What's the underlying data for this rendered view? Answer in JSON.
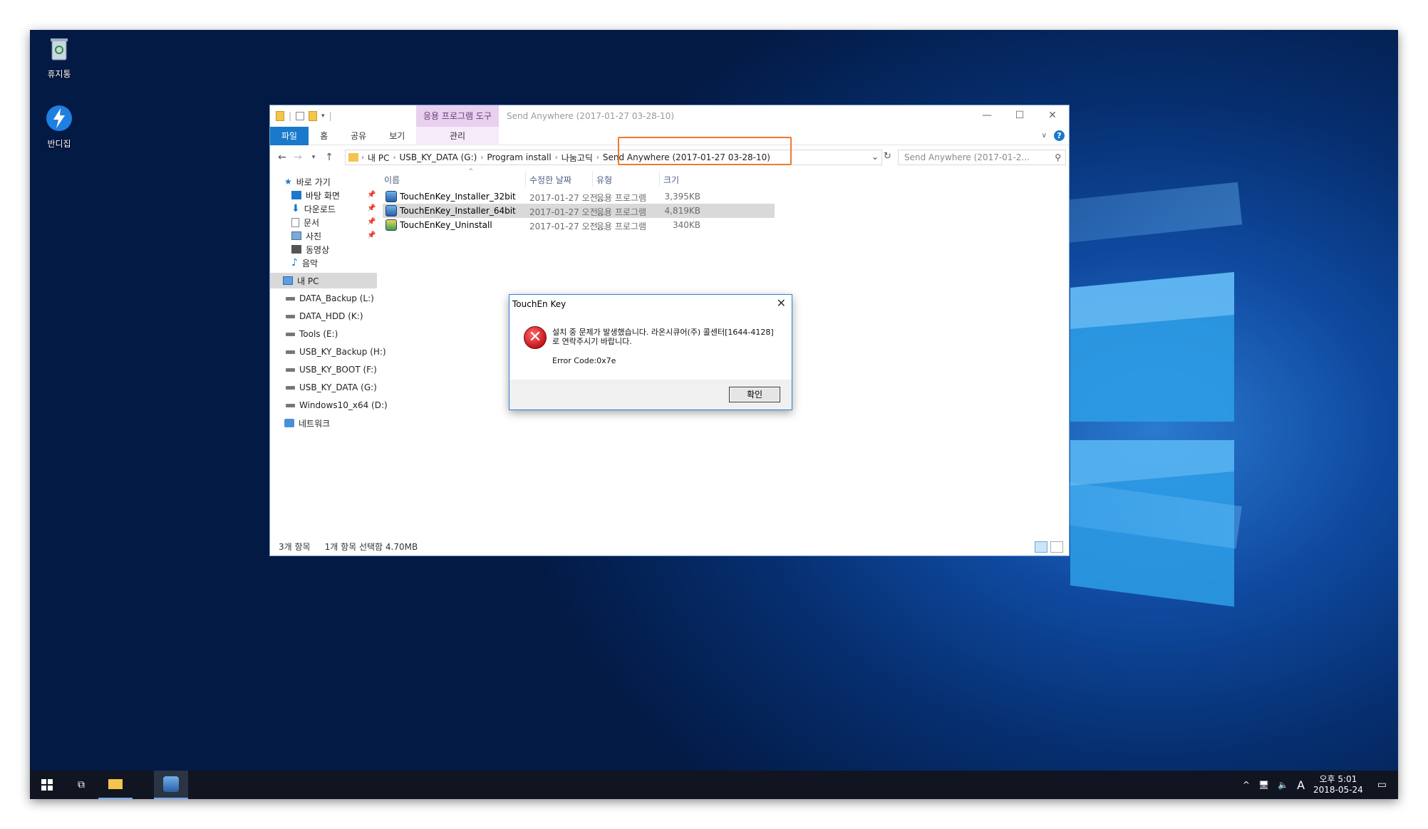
{
  "desktop": {
    "icons": [
      {
        "label": "휴지통"
      },
      {
        "label": "반디집"
      }
    ]
  },
  "explorer": {
    "context_tab": "응용 프로그램 도구",
    "title": "Send Anywhere (2017-01-27 03-28-10)",
    "window_buttons": [
      "—",
      "☐",
      "✕"
    ],
    "ribbon_tabs": [
      "파일",
      "홈",
      "공유",
      "보기"
    ],
    "manage_tab": "관리",
    "breadcrumb": [
      "내 PC",
      "USB_KY_DATA (G:)",
      "Program install",
      "나눔고딕",
      "Send Anywhere (2017-01-27 03-28-10)"
    ],
    "search_placeholder": "Send Anywhere (2017-01-2...",
    "nav_pane": {
      "quick_access": "바로 가기",
      "quick_items": [
        "바탕 화면",
        "다운로드",
        "문서",
        "사진",
        "동영상",
        "음악"
      ],
      "this_pc": "내 PC",
      "drives": [
        "DATA_Backup (L:)",
        "DATA_HDD (K:)",
        "Tools (E:)",
        "USB_KY_Backup (H:)",
        "USB_KY_BOOT (F:)",
        "USB_KY_DATA (G:)",
        "Windows10_x64 (D:)"
      ],
      "network": "네트워크"
    },
    "columns": [
      "이름",
      "수정한 날짜",
      "유형",
      "크기"
    ],
    "files": [
      {
        "name": "TouchEnKey_Installer_32bit",
        "date": "2017-01-27 오전...",
        "type": "응용 프로그램",
        "size": "3,395KB"
      },
      {
        "name": "TouchEnKey_Installer_64bit",
        "date": "2017-01-27 오전...",
        "type": "응용 프로그램",
        "size": "4,819KB"
      },
      {
        "name": "TouchEnKey_Uninstall",
        "date": "2017-01-27 오전...",
        "type": "응용 프로그램",
        "size": "340KB"
      }
    ],
    "status": {
      "count": "3개 항목",
      "selection": "1개 항목 선택함 4.70MB"
    }
  },
  "dialog": {
    "title": "TouchEn Key",
    "message_line1": "설치 중 문제가 발생했습니다. 라온시큐어(주) 콜센터[1644-4128]",
    "message_line2": "로 연락주시기 바랍니다.",
    "error_code": "Error Code:0x7e",
    "ok_label": "확인"
  },
  "taskbar": {
    "time": "오후 5:01",
    "date": "2018-05-24",
    "ime": "A"
  },
  "colors": {
    "accent": "#1979ca",
    "highlight_box": "#f07a2c",
    "error_red": "#c4141a"
  }
}
